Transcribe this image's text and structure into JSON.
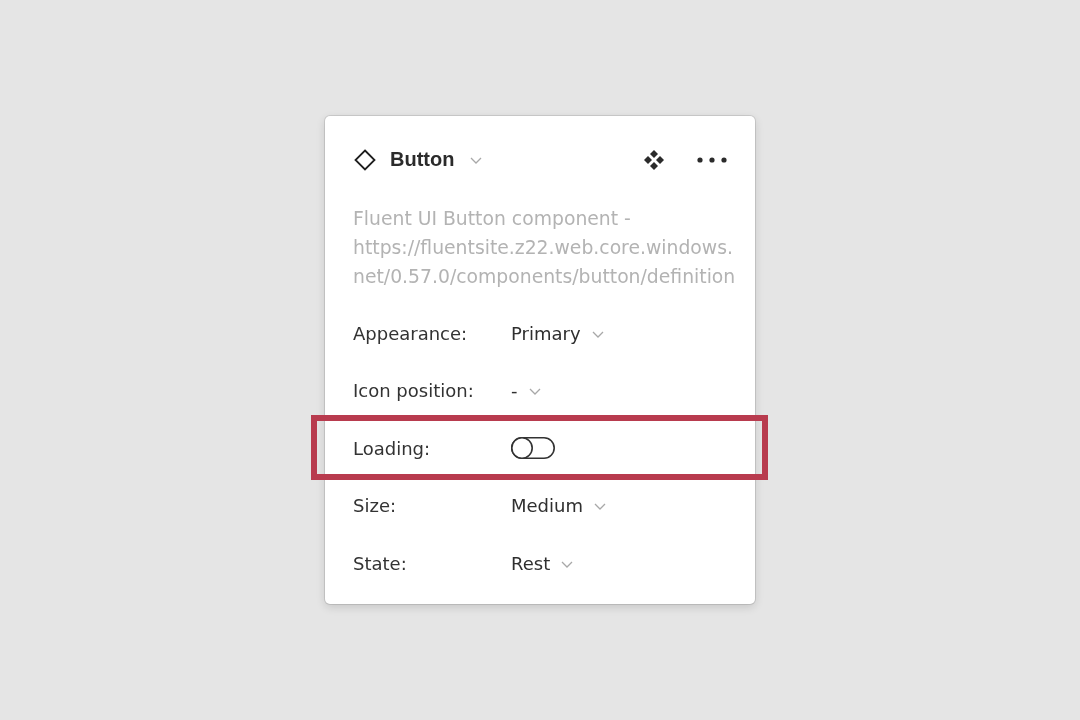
{
  "component": {
    "title": "Button",
    "description": "Fluent UI Button component - https://fluentsite.z22.web.core.windows.net/0.57.0/components/button/definition"
  },
  "properties": [
    {
      "label": "Appearance:",
      "kind": "dropdown",
      "value": "Primary",
      "highlighted": false
    },
    {
      "label": "Icon position:",
      "kind": "dropdown",
      "value": "-",
      "highlighted": false
    },
    {
      "label": "Loading:",
      "kind": "toggle",
      "on": false,
      "highlighted": true
    },
    {
      "label": "Size:",
      "kind": "dropdown",
      "value": "Medium",
      "highlighted": false
    },
    {
      "label": "State:",
      "kind": "dropdown",
      "value": "Rest",
      "highlighted": false
    }
  ]
}
